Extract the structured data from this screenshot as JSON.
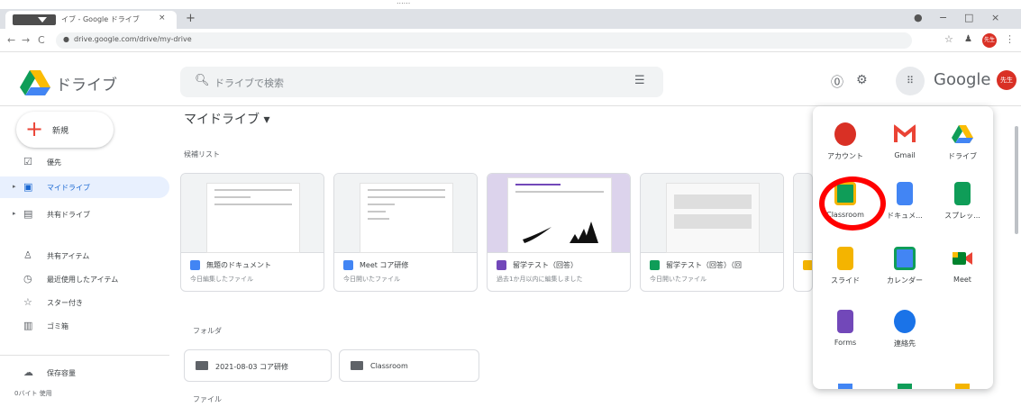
{
  "caption": "......",
  "browser": {
    "tab_title": "イブ - Google ドライブ",
    "tab_close": "×",
    "new_tab": "+",
    "url": "drive.google.com/drive/my-drive",
    "win_min": "−",
    "win_max": "□",
    "win_close": "×",
    "profile_initials": "先生"
  },
  "header": {
    "logo_text": "ドライブ",
    "search_placeholder": "ドライブで検索",
    "brand": "Google",
    "avatar_initials": "先生"
  },
  "sidebar": {
    "new_label": "新規",
    "items": [
      {
        "label": "優先",
        "icon": "priority-icon"
      },
      {
        "label": "マイドライブ",
        "icon": "my-drive-icon"
      },
      {
        "label": "共有ドライブ",
        "icon": "shared-drives-icon"
      },
      {
        "label": "共有アイテム",
        "icon": "shared-with-me-icon"
      },
      {
        "label": "最近使用したアイテム",
        "icon": "clock-icon"
      },
      {
        "label": "スター付き",
        "icon": "star-icon"
      },
      {
        "label": "ゴミ箱",
        "icon": "trash-icon"
      },
      {
        "label": "保存容量",
        "icon": "cloud-icon"
      }
    ],
    "quota": "0バイト 使用"
  },
  "main": {
    "title": "マイドライブ ▾",
    "quick_access_label": "候補リスト",
    "folders_label": "フォルダ",
    "files_label": "ファイル",
    "cards": [
      {
        "name": "無題のドキュメント",
        "sub": "今日編集したファイル",
        "color": "#4285f4"
      },
      {
        "name": "Meet コア研修",
        "sub": "今日開いたファイル",
        "color": "#4285f4"
      },
      {
        "name": "留学テスト（回答）",
        "sub": "過去1か月以内に編集しました",
        "color": "#7248b9"
      },
      {
        "name": "留学テスト（回答）（回",
        "sub": "今日開いたファイル",
        "color": "#0f9d58"
      }
    ],
    "folders": [
      {
        "name": "2021-08-03 コア研修"
      },
      {
        "name": "Classroom"
      }
    ]
  },
  "apps_panel": {
    "apps": [
      {
        "label": "アカウント",
        "icon": "account-icon",
        "color": "#d93025"
      },
      {
        "label": "Gmail",
        "icon": "gmail-icon",
        "color": "#ea4335"
      },
      {
        "label": "ドライブ",
        "icon": "drive-icon",
        "color": "#fbbc04"
      },
      {
        "label": "Classroom",
        "icon": "classroom-icon",
        "color": "#0f9d58"
      },
      {
        "label": "ドキュメ...",
        "icon": "docs-icon",
        "color": "#4285f4"
      },
      {
        "label": "スプレッ...",
        "icon": "sheets-icon",
        "color": "#0f9d58"
      },
      {
        "label": "スライド",
        "icon": "slides-icon",
        "color": "#f4b400"
      },
      {
        "label": "カレンダー",
        "icon": "calendar-icon",
        "color": "#4285f4"
      },
      {
        "label": "Meet",
        "icon": "meet-icon",
        "color": "#00832d"
      },
      {
        "label": "Forms",
        "icon": "forms-icon",
        "color": "#7248b9"
      },
      {
        "label": "連絡先",
        "icon": "contacts-icon",
        "color": "#1a73e8"
      }
    ]
  },
  "colors": {
    "accent": "#1a73e8",
    "active_nav_bg": "#e8f0fe",
    "highlight": "#ff0000"
  }
}
